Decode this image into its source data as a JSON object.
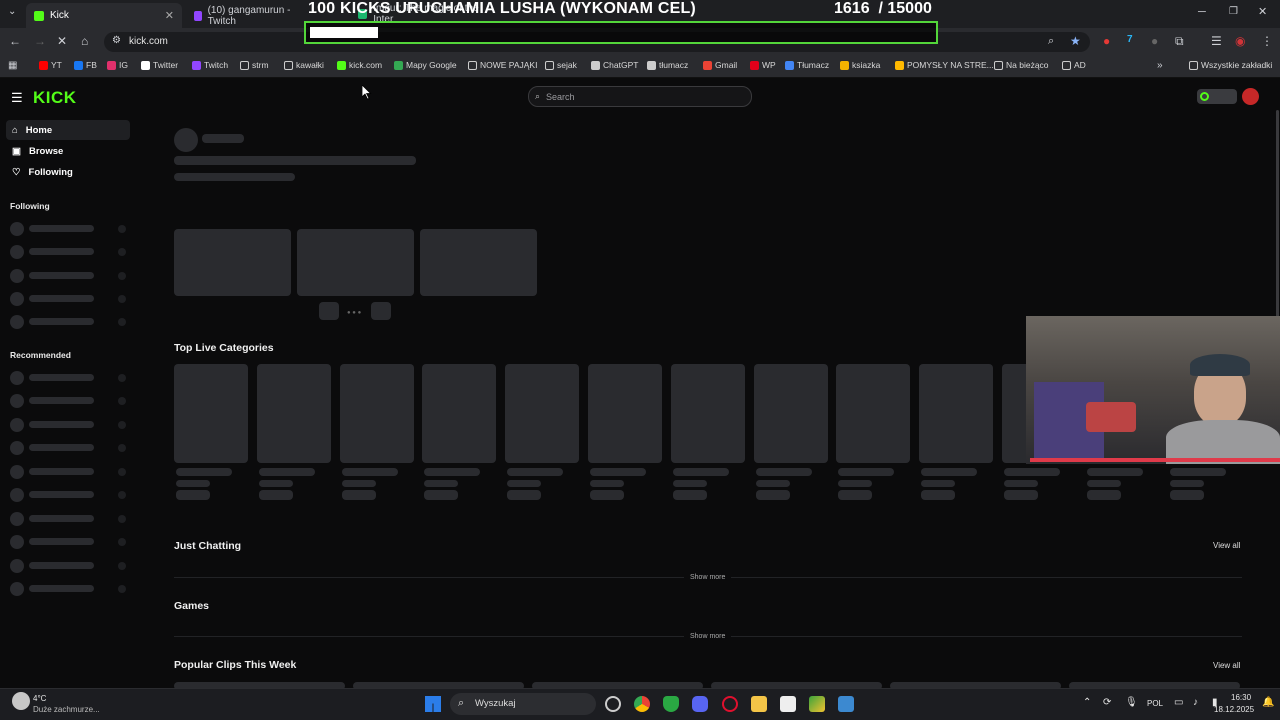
{
  "browser": {
    "tabs": [
      {
        "label": "Kick",
        "active": true,
        "color": "#53fc18"
      },
      {
        "label": "(10) gangamurun - Twitch",
        "active": false,
        "color": "#9146ff"
      },
      {
        "label": "Imgur: The magic of the Inter",
        "active": false,
        "color": "#1bb76e"
      }
    ],
    "url": "kick.com",
    "bookmarks": [
      {
        "label": "YT",
        "color": "#ff0000"
      },
      {
        "label": "FB",
        "color": "#1877f2"
      },
      {
        "label": "IG",
        "color": "#e1306c"
      },
      {
        "label": "Twitter",
        "color": "#ffffff"
      },
      {
        "label": "Twitch",
        "color": "#9146ff"
      },
      {
        "label": "strm",
        "color": "folder"
      },
      {
        "label": "kawałki",
        "color": "folder"
      },
      {
        "label": "kick.com",
        "color": "#53fc18"
      },
      {
        "label": "Mapy Google",
        "color": "#34a853"
      },
      {
        "label": "NOWE PAJĄKI",
        "color": "folder"
      },
      {
        "label": "sejak",
        "color": "folder"
      },
      {
        "label": "ChatGPT",
        "color": "#cccccc"
      },
      {
        "label": "tłumacz",
        "color": "#cccccc"
      },
      {
        "label": "Gmail",
        "color": "#ea4335"
      },
      {
        "label": "WP",
        "color": "#e2001a"
      },
      {
        "label": "Tłumacz",
        "color": "#4285f4"
      },
      {
        "label": "ksiazka",
        "color": "#f3b200"
      },
      {
        "label": "POMYSŁY NA STRE...",
        "color": "#ffb900"
      },
      {
        "label": "Na bieżąco",
        "color": "folder"
      },
      {
        "label": "AD",
        "color": "folder"
      }
    ],
    "all_bookmarks": "Wszystkie zakładki"
  },
  "overlay": {
    "goal_text": "100 KICKS URUCHAMIA LUSHA (WYKONAM CEL)",
    "goal_current": "1616",
    "goal_total": "/ 15000",
    "progress": 0.108
  },
  "kick": {
    "search_placeholder": "Search",
    "nav": [
      {
        "label": "Home",
        "icon": "home-icon"
      },
      {
        "label": "Browse",
        "icon": "compass-icon"
      },
      {
        "label": "Following",
        "icon": "heart-icon"
      }
    ],
    "following_heading": "Following",
    "recommended_heading": "Recommended",
    "top_live_categories": "Top Live Categories",
    "just_chatting": "Just Chatting",
    "games": "Games",
    "popular_clips": "Popular Clips This Week",
    "view_all": "View all",
    "show_more": "Show more"
  },
  "taskbar": {
    "weather_temp": "4°C",
    "weather_desc": "Duże zachmurze...",
    "search": "Wyszukaj",
    "lang": "POL",
    "time": "16:30",
    "date": "18.12.2025"
  },
  "colors": {
    "kick_green": "#53fc18",
    "goal_border": "#53d63a"
  }
}
